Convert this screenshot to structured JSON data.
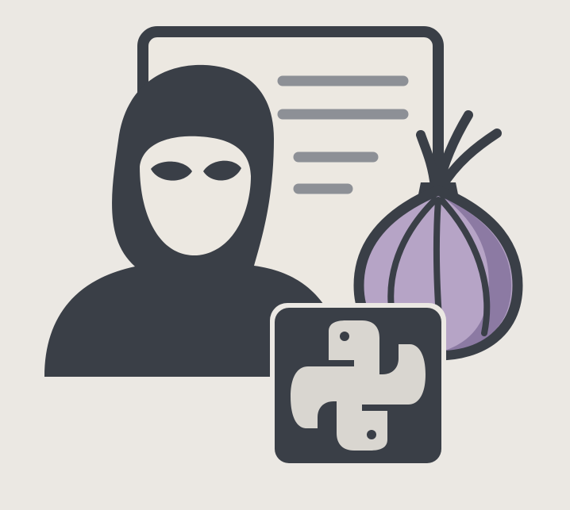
{
  "illustration": {
    "elements": [
      "document-icon",
      "hacker-icon",
      "tor-onion-icon",
      "python-logo-icon"
    ]
  },
  "colors": {
    "background": "#ebe8e3",
    "dark": "#3a3f47",
    "paper": "#ece8e1",
    "text_line": "#8d9096",
    "onion_light": "#b6a4c6",
    "onion_dark": "#8c7aa3",
    "python_light": "#d9d6d0"
  }
}
